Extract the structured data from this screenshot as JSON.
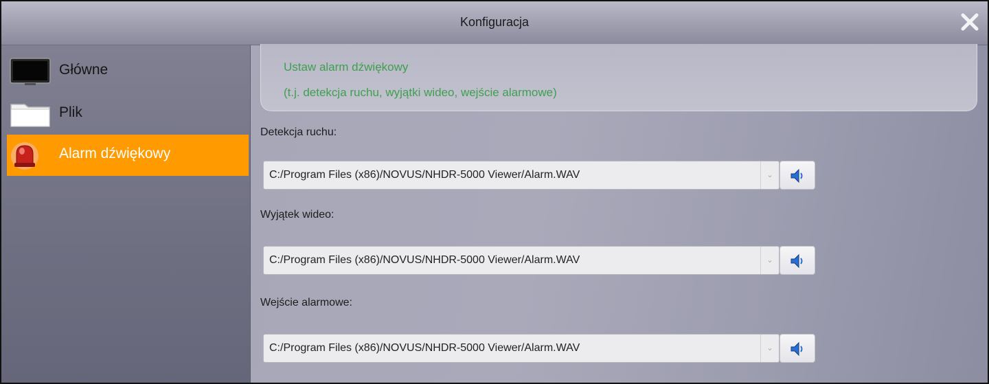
{
  "window": {
    "title": "Konfiguracja",
    "close_icon": "close-icon"
  },
  "sidebar": {
    "items": [
      {
        "label": "Główne",
        "icon": "monitor-icon",
        "active": false
      },
      {
        "label": "Plik",
        "icon": "folder-icon",
        "active": false
      },
      {
        "label": "Alarm dźwiękowy",
        "icon": "alarm-siren-icon",
        "active": true
      }
    ]
  },
  "main": {
    "info": {
      "line1": "Ustaw alarm dźwiękowy",
      "line2": "(t.j. detekcja ruchu, wyjątki wideo, wejście alarmowe)"
    },
    "fields": [
      {
        "label": "Detekcja ruchu:",
        "value": "C:/Program Files (x86)/NOVUS/NHDR-5000 Viewer/Alarm.WAV"
      },
      {
        "label": "Wyjątek wideo:",
        "value": "C:/Program Files (x86)/NOVUS/NHDR-5000 Viewer/Alarm.WAV"
      },
      {
        "label": "Wejście alarmowe:",
        "value": "C:/Program Files (x86)/NOVUS/NHDR-5000 Viewer/Alarm.WAV"
      }
    ],
    "play_icon": "speaker-icon"
  },
  "colors": {
    "accent": "#ff9a00",
    "info_text": "#3f9f4f"
  }
}
